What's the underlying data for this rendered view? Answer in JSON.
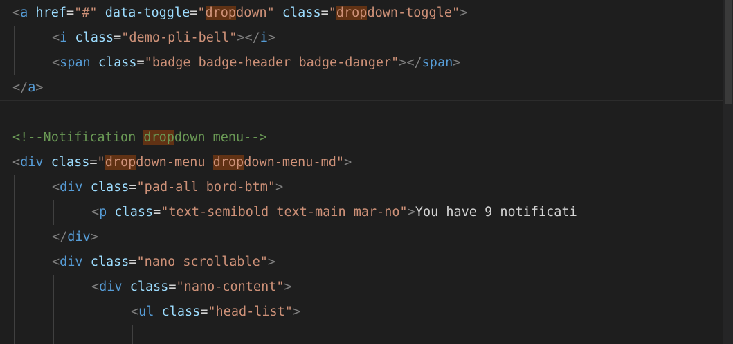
{
  "editor": {
    "theme_colors": {
      "background": "#1e1e1e",
      "tag": "#569cd6",
      "attribute": "#9cdcfe",
      "string": "#ce9178",
      "comment": "#6a9955",
      "find_highlight": "#613214"
    },
    "search_highlight_term": "drop",
    "lines": [
      {
        "indent": 0,
        "tokens": [
          {
            "t": "angle",
            "v": "<"
          },
          {
            "t": "tag",
            "v": "a"
          },
          {
            "t": "text",
            "v": " "
          },
          {
            "t": "attr",
            "v": "href"
          },
          {
            "t": "eq",
            "v": "="
          },
          {
            "t": "str",
            "v": "\"#\""
          },
          {
            "t": "text",
            "v": " "
          },
          {
            "t": "attr",
            "v": "data-toggle"
          },
          {
            "t": "eq",
            "v": "="
          },
          {
            "t": "str",
            "v": "\""
          },
          {
            "t": "str hl",
            "v": "drop"
          },
          {
            "t": "str",
            "v": "down\""
          },
          {
            "t": "text",
            "v": " "
          },
          {
            "t": "attr",
            "v": "class"
          },
          {
            "t": "eq",
            "v": "="
          },
          {
            "t": "str",
            "v": "\""
          },
          {
            "t": "str hl",
            "v": "drop"
          },
          {
            "t": "str",
            "v": "down-toggle\""
          },
          {
            "t": "angle",
            "v": ">"
          }
        ]
      },
      {
        "indent": 1,
        "tokens": [
          {
            "t": "angle",
            "v": "<"
          },
          {
            "t": "tag",
            "v": "i"
          },
          {
            "t": "text",
            "v": " "
          },
          {
            "t": "attr",
            "v": "class"
          },
          {
            "t": "eq",
            "v": "="
          },
          {
            "t": "str",
            "v": "\"demo-pli-bell\""
          },
          {
            "t": "angle",
            "v": "></"
          },
          {
            "t": "tag",
            "v": "i"
          },
          {
            "t": "angle",
            "v": ">"
          }
        ]
      },
      {
        "indent": 1,
        "tokens": [
          {
            "t": "angle",
            "v": "<"
          },
          {
            "t": "tag",
            "v": "span"
          },
          {
            "t": "text",
            "v": " "
          },
          {
            "t": "attr",
            "v": "class"
          },
          {
            "t": "eq",
            "v": "="
          },
          {
            "t": "str",
            "v": "\"badge badge-header badge-danger\""
          },
          {
            "t": "angle",
            "v": "></"
          },
          {
            "t": "tag",
            "v": "span"
          },
          {
            "t": "angle",
            "v": ">"
          }
        ]
      },
      {
        "indent": 0,
        "tokens": [
          {
            "t": "angle",
            "v": "</"
          },
          {
            "t": "tag",
            "v": "a"
          },
          {
            "t": "angle",
            "v": ">"
          }
        ]
      },
      {
        "indent": 0,
        "current": true,
        "tokens": []
      },
      {
        "indent": 0,
        "tokens": [
          {
            "t": "comment",
            "v": "<!--Notification "
          },
          {
            "t": "comment hl",
            "v": "drop"
          },
          {
            "t": "comment",
            "v": "down menu-->"
          }
        ]
      },
      {
        "indent": 0,
        "tokens": [
          {
            "t": "angle",
            "v": "<"
          },
          {
            "t": "tag",
            "v": "div"
          },
          {
            "t": "text",
            "v": " "
          },
          {
            "t": "attr",
            "v": "class"
          },
          {
            "t": "eq",
            "v": "="
          },
          {
            "t": "str",
            "v": "\""
          },
          {
            "t": "str hl",
            "v": "drop"
          },
          {
            "t": "str",
            "v": "down-menu "
          },
          {
            "t": "str hl",
            "v": "drop"
          },
          {
            "t": "str",
            "v": "down-menu-md\""
          },
          {
            "t": "angle",
            "v": ">"
          }
        ]
      },
      {
        "indent": 1,
        "tokens": [
          {
            "t": "angle",
            "v": "<"
          },
          {
            "t": "tag",
            "v": "div"
          },
          {
            "t": "text",
            "v": " "
          },
          {
            "t": "attr",
            "v": "class"
          },
          {
            "t": "eq",
            "v": "="
          },
          {
            "t": "str",
            "v": "\"pad-all bord-btm\""
          },
          {
            "t": "angle",
            "v": ">"
          }
        ]
      },
      {
        "indent": 2,
        "tokens": [
          {
            "t": "angle",
            "v": "<"
          },
          {
            "t": "tag",
            "v": "p"
          },
          {
            "t": "text",
            "v": " "
          },
          {
            "t": "attr",
            "v": "class"
          },
          {
            "t": "eq",
            "v": "="
          },
          {
            "t": "str",
            "v": "\"text-semibold text-main mar-no\""
          },
          {
            "t": "angle",
            "v": ">"
          },
          {
            "t": "text",
            "v": "You have 9 notificati"
          }
        ]
      },
      {
        "indent": 1,
        "tokens": [
          {
            "t": "angle",
            "v": "</"
          },
          {
            "t": "tag",
            "v": "div"
          },
          {
            "t": "angle",
            "v": ">"
          }
        ]
      },
      {
        "indent": 1,
        "tokens": [
          {
            "t": "angle",
            "v": "<"
          },
          {
            "t": "tag",
            "v": "div"
          },
          {
            "t": "text",
            "v": " "
          },
          {
            "t": "attr",
            "v": "class"
          },
          {
            "t": "eq",
            "v": "="
          },
          {
            "t": "str",
            "v": "\"nano scrollable\""
          },
          {
            "t": "angle",
            "v": ">"
          }
        ]
      },
      {
        "indent": 2,
        "tokens": [
          {
            "t": "angle",
            "v": "<"
          },
          {
            "t": "tag",
            "v": "div"
          },
          {
            "t": "text",
            "v": " "
          },
          {
            "t": "attr",
            "v": "class"
          },
          {
            "t": "eq",
            "v": "="
          },
          {
            "t": "str",
            "v": "\"nano-content\""
          },
          {
            "t": "angle",
            "v": ">"
          }
        ]
      },
      {
        "indent": 3,
        "tokens": [
          {
            "t": "angle",
            "v": "<"
          },
          {
            "t": "tag",
            "v": "ul"
          },
          {
            "t": "text",
            "v": " "
          },
          {
            "t": "attr",
            "v": "class"
          },
          {
            "t": "eq",
            "v": "="
          },
          {
            "t": "str",
            "v": "\"head-list\""
          },
          {
            "t": "angle",
            "v": ">"
          }
        ]
      },
      {
        "indent": 4,
        "tokens": []
      }
    ]
  }
}
